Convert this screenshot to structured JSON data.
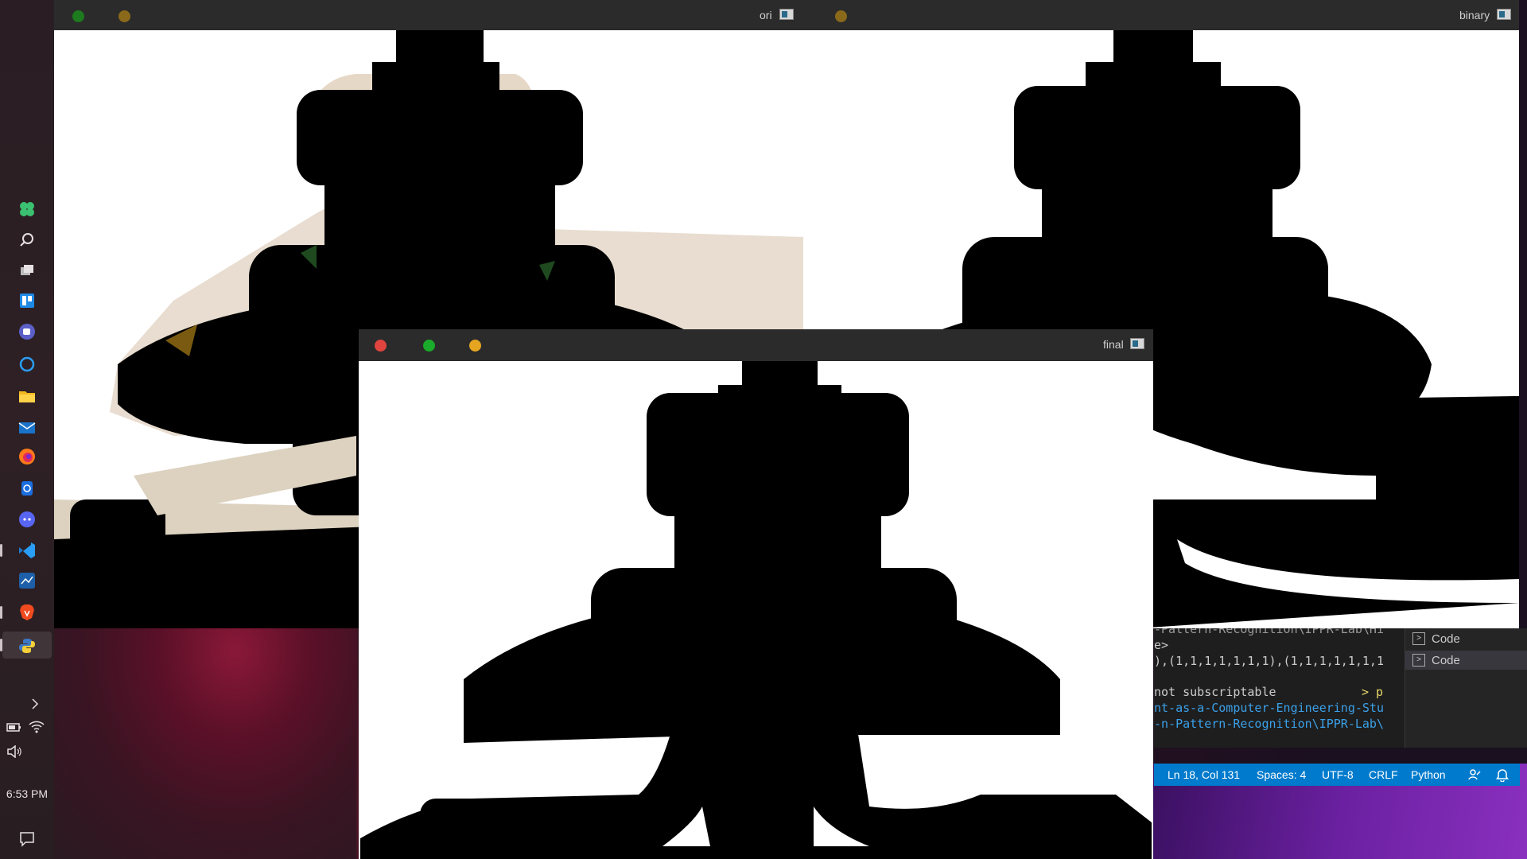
{
  "windows": {
    "ori": {
      "title": "ori"
    },
    "binary": {
      "title": "binary"
    },
    "final": {
      "title": "final"
    }
  },
  "taskbar": {
    "icons": [
      "clover-icon",
      "search-icon",
      "task-view-icon",
      "trello-icon",
      "teams-icon",
      "cortana-icon",
      "file-explorer-icon",
      "mail-icon",
      "firefox-icon",
      "app-icon",
      "discord-icon",
      "vscode-icon",
      "app-icon",
      "brave-icon",
      "python-icon"
    ],
    "clock": "6:53 PM"
  },
  "terminal": {
    "lines": [
      {
        "text": "-Pattern-Recognition\\IPPR-Lab\\Hi",
        "style": "dim"
      },
      {
        "text": "e>",
        "style": "normal"
      },
      {
        "text": "),(1,1,1,1,1,1,1),(1,1,1,1,1,1,1",
        "style": "normal"
      },
      {
        "text": "not subscriptable",
        "style": "normal"
      },
      {
        "text": "nt-as-a-Computer-Engineering-Stu",
        "style": "blue"
      },
      {
        "text": "-n-Pattern-Recognition\\IPPR-Lab\\",
        "style": "blue"
      }
    ],
    "prompt": "> p"
  },
  "terminal_list": [
    "Code",
    "Code"
  ],
  "statusbar": {
    "position": "Ln 18, Col 131",
    "spaces": "Spaces: 4",
    "encoding": "UTF-8",
    "eol": "CRLF",
    "language": "Python"
  }
}
